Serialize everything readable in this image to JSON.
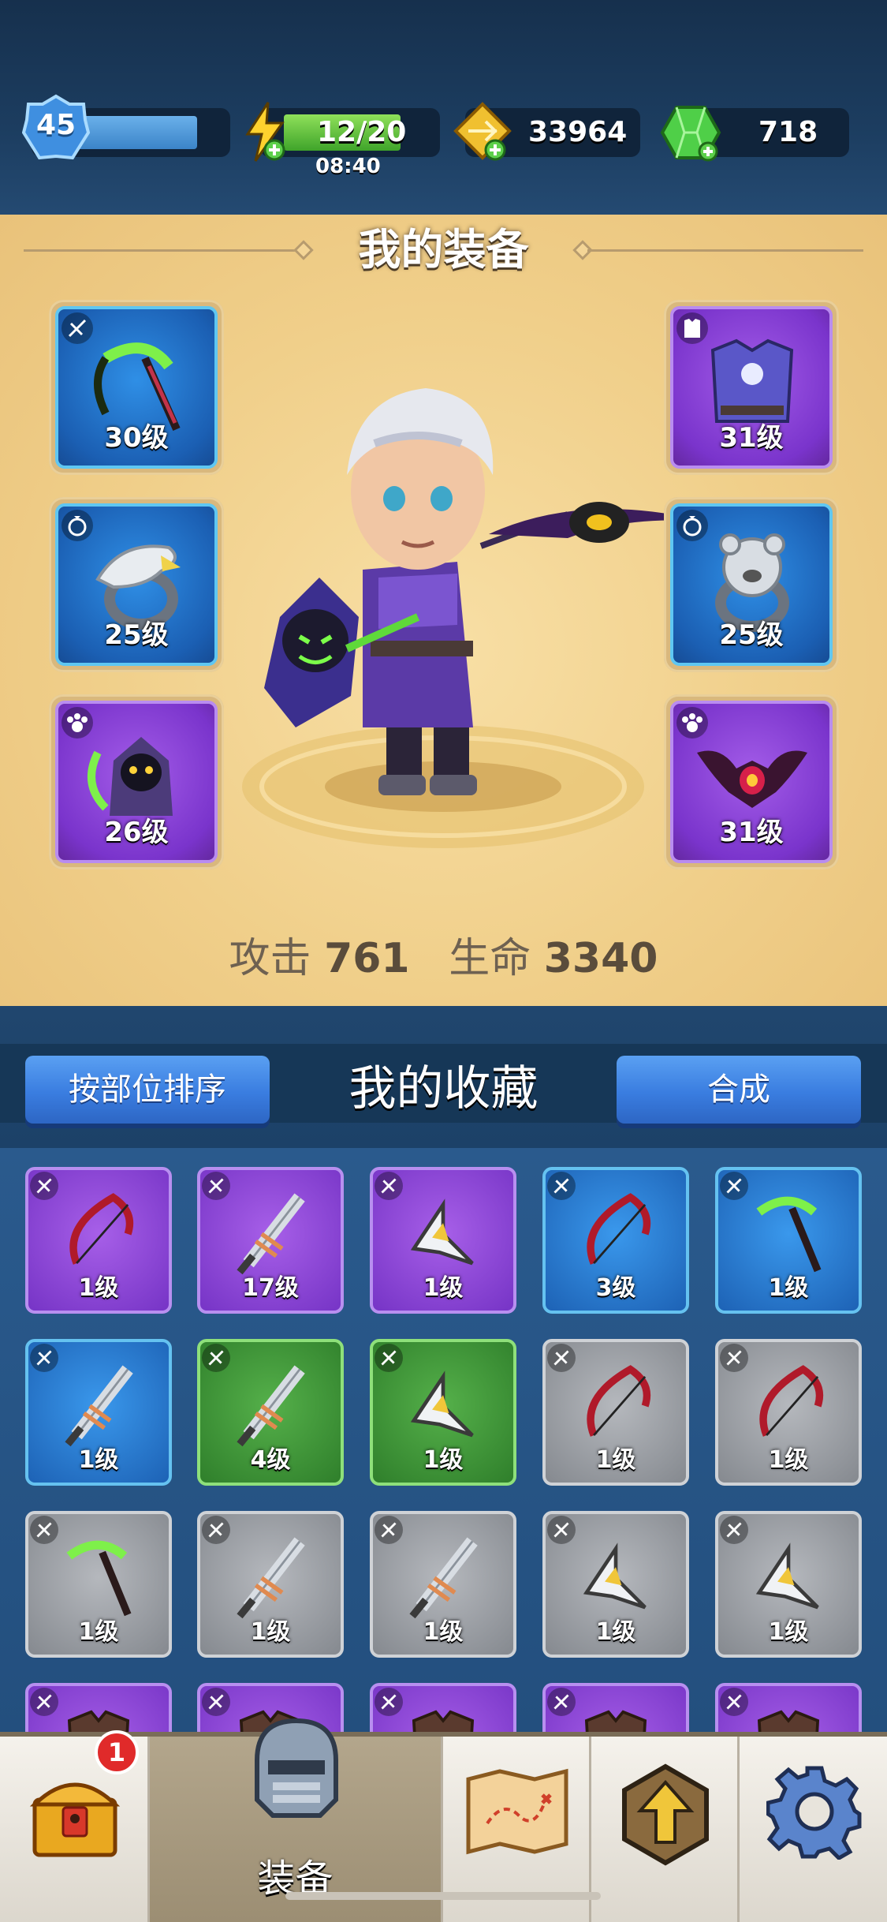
{
  "topbar": {
    "level": "45",
    "energy": "12/20",
    "energy_timer": "08:40",
    "gold": "33964",
    "gems": "718"
  },
  "equipment": {
    "title": "我的装备",
    "slots": [
      {
        "level": "30级",
        "rarity": "blue",
        "item": "scythe-icon",
        "category": "weapon-icon"
      },
      {
        "level": "25级",
        "rarity": "blue",
        "item": "eagle-ring-icon",
        "category": "ring-icon"
      },
      {
        "level": "26级",
        "rarity": "purple",
        "item": "reaper-pet-icon",
        "category": "pet-icon"
      },
      {
        "level": "31级",
        "rarity": "purple",
        "item": "armor-icon",
        "category": "armor-slot-icon"
      },
      {
        "level": "25级",
        "rarity": "blue",
        "item": "bear-ring-icon",
        "category": "ring-icon"
      },
      {
        "level": "31级",
        "rarity": "purple",
        "item": "bat-pet-icon",
        "category": "pet-icon"
      }
    ],
    "stats": {
      "attack_label": "攻击",
      "attack_value": "761",
      "hp_label": "生命",
      "hp_value": "3340"
    }
  },
  "collection": {
    "sort_button": "按部位排序",
    "title": "我的收藏",
    "merge_button": "合成",
    "items": [
      {
        "level": "1级",
        "rarity": "purple",
        "item": "bow-icon"
      },
      {
        "level": "17级",
        "rarity": "purple",
        "item": "sword-icon"
      },
      {
        "level": "1级",
        "rarity": "purple",
        "item": "shuriken-icon"
      },
      {
        "level": "3级",
        "rarity": "blue",
        "item": "bow-icon"
      },
      {
        "level": "1级",
        "rarity": "blue",
        "item": "scythe-icon"
      },
      {
        "level": "1级",
        "rarity": "blue",
        "item": "sword-icon"
      },
      {
        "level": "4级",
        "rarity": "green",
        "item": "sword-icon"
      },
      {
        "level": "1级",
        "rarity": "green",
        "item": "shuriken-icon"
      },
      {
        "level": "1级",
        "rarity": "gray",
        "item": "bow-icon"
      },
      {
        "level": "1级",
        "rarity": "gray",
        "item": "bow-icon"
      },
      {
        "level": "1级",
        "rarity": "gray",
        "item": "scythe-icon"
      },
      {
        "level": "1级",
        "rarity": "gray",
        "item": "sword-icon"
      },
      {
        "level": "1级",
        "rarity": "gray",
        "item": "sword-icon"
      },
      {
        "level": "1级",
        "rarity": "gray",
        "item": "shuriken-icon"
      },
      {
        "level": "1级",
        "rarity": "gray",
        "item": "shuriken-icon"
      },
      {
        "level": "",
        "rarity": "purple",
        "item": "armor-icon"
      },
      {
        "level": "",
        "rarity": "purple",
        "item": "armor-icon"
      },
      {
        "level": "",
        "rarity": "purple",
        "item": "armor-icon"
      },
      {
        "level": "",
        "rarity": "purple",
        "item": "armor-icon"
      },
      {
        "level": "",
        "rarity": "purple",
        "item": "armor-icon"
      }
    ]
  },
  "nav": {
    "chest_badge": "1",
    "equip_label": "装备",
    "items": [
      "treasure-chest-icon",
      "helmet-icon",
      "map-icon",
      "upgrade-arrow-icon",
      "gear-icon"
    ]
  },
  "colors": {
    "rarity_blue": "#1d62b5",
    "rarity_purple": "#7634c6",
    "rarity_green": "#2f7f2b",
    "rarity_gray": "#85898f",
    "button_blue": "#3a7de0"
  }
}
